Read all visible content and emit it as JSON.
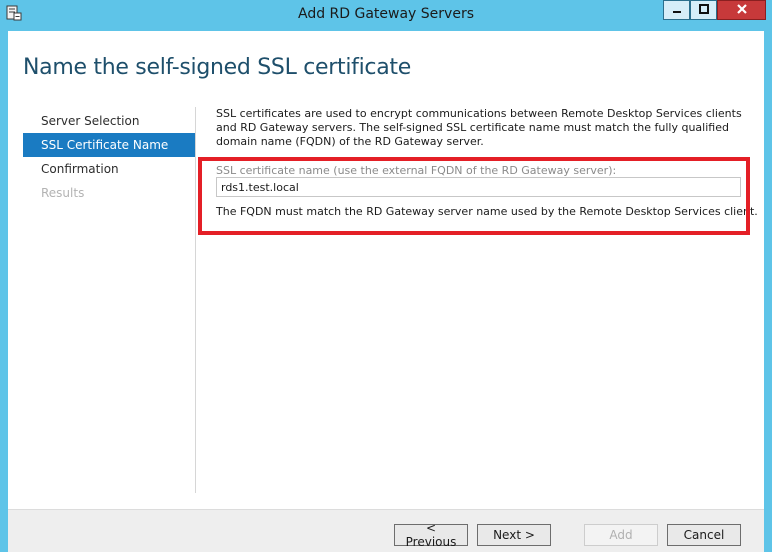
{
  "window": {
    "title": "Add RD Gateway Servers",
    "controls": {
      "minimize": "—",
      "maximize": "□",
      "close": "✕"
    },
    "icon": "server-manager-icon"
  },
  "page": {
    "title": "Name the self-signed SSL certificate"
  },
  "nav": {
    "items": [
      {
        "label": "Server Selection",
        "state": "normal"
      },
      {
        "label": "SSL Certificate Name",
        "state": "active"
      },
      {
        "label": "Confirmation",
        "state": "normal"
      },
      {
        "label": "Results",
        "state": "disabled"
      }
    ]
  },
  "content": {
    "description": "SSL certificates are used to encrypt communications between Remote Desktop Services clients and RD Gateway servers. The self-signed SSL certificate name must match the fully qualified domain name (FQDN) of the RD Gateway server.",
    "field_label": "SSL certificate name (use the external FQDN of the RD Gateway server):",
    "field_value": "rds1.test.local",
    "field_note": "The FQDN must match the RD Gateway server name used by the Remote Desktop Services client."
  },
  "footer": {
    "previous": "< Previous",
    "next": "Next >",
    "add": "Add",
    "cancel": "Cancel"
  },
  "colors": {
    "titlebar": "#5ec4e8",
    "active_nav": "#1a7bc2",
    "highlight": "#e41f26",
    "title_text": "#1e4f6b"
  }
}
